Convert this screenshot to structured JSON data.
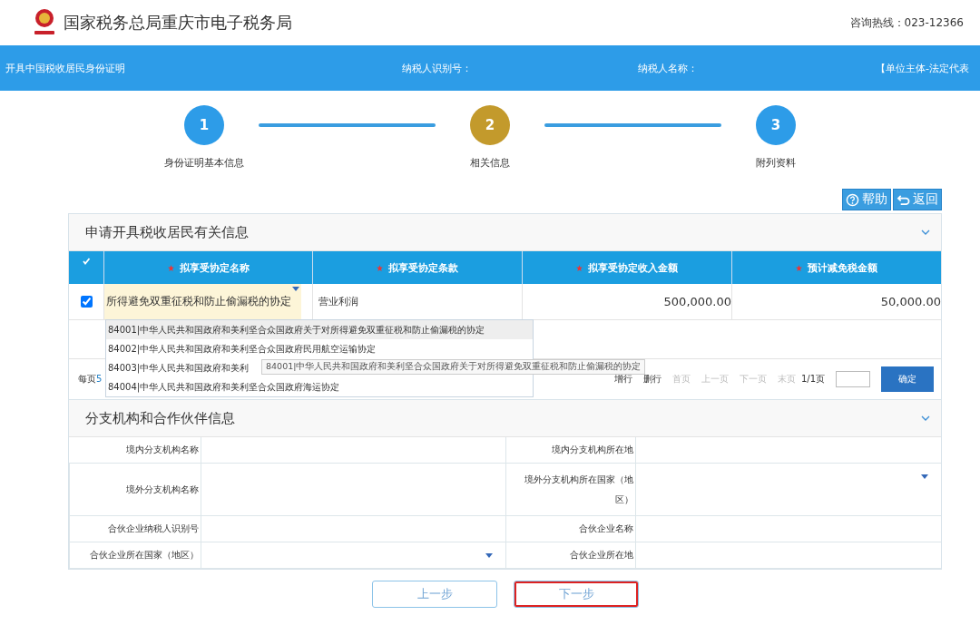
{
  "header": {
    "title": "国家税务总局重庆市电子税务局",
    "hotline": "咨询热线：023-12366"
  },
  "infobar": {
    "items": [
      "开具中国税收居民身份证明",
      "纳税人识别号：",
      "纳税人名称：",
      "【单位主体-法定代表"
    ]
  },
  "steps": [
    {
      "number": "1",
      "label": "身份证明基本信息",
      "current": false
    },
    {
      "number": "2",
      "label": "相关信息",
      "current": true
    },
    {
      "number": "3",
      "label": "附列资料",
      "current": false
    }
  ],
  "tools": [
    "帮助",
    "返回"
  ],
  "treaty_panel": {
    "title": "申请开具税收居民有关信息",
    "expanded": true,
    "header_checked": true,
    "columns": [
      {
        "label": "拟享受协定名称",
        "required": true
      },
      {
        "label": "拟享受协定条款",
        "required": true
      },
      {
        "label": "拟享受协定收入金额",
        "required": true
      },
      {
        "label": "预计减免税金额",
        "required": true
      }
    ],
    "rows": [
      {
        "checked": true,
        "cells": [
          "所得避免双重征税和防止偷漏税的协定",
          "营业利润",
          "500,000.00",
          "50,000.00"
        ]
      }
    ],
    "dropdown": [
      {
        "text": "84001|中华人民共和国政府和美利坚合众国政府关于对所得避免双重征税和防止偷漏税的协定",
        "selected": true
      },
      {
        "text": "84002|中华人民共和国政府和美利坚合众国政府民用航空运输协定",
        "selected": false
      },
      {
        "text": "84003|中华人民共和国政府和美利",
        "selected": false
      },
      {
        "text": "84004|中华人民共和国政府和美利坚合众国政府海运协定",
        "selected": false
      }
    ],
    "tooltip": "84001|中华人民共和国政府和美利坚合众国政府关于对所得避免双重征税和防止偷漏税的协定",
    "pager": {
      "per_page_label": "每页",
      "per_page_value": "5",
      "actions": [
        {
          "label": "增行",
          "disabled": false
        },
        {
          "label": "删行",
          "disabled": false
        },
        {
          "label": "首页",
          "disabled": true
        },
        {
          "label": "上一页",
          "disabled": true
        },
        {
          "label": "下一页",
          "disabled": true
        },
        {
          "label": "末页",
          "disabled": true
        }
      ],
      "page": "1/1页",
      "confirm": "确定"
    }
  },
  "branch_panel": {
    "title": "分支机构和合作伙伴信息",
    "expanded": true,
    "rows": [
      [
        {
          "label": "境内分支机构名称",
          "kind": "text"
        },
        {
          "label": "境内分支机构所在地",
          "kind": "text"
        }
      ],
      [
        {
          "label": "境外分支机构名称",
          "kind": "text"
        },
        {
          "label": "境外分支机构所在国家（地区）",
          "kind": "select"
        }
      ],
      [
        {
          "label": "合伙企业纳税人识别号",
          "kind": "text"
        },
        {
          "label": "合伙企业名称",
          "kind": "text"
        }
      ],
      [
        {
          "label": "合伙企业所在国家（地区）",
          "kind": "select"
        },
        {
          "label": "合伙企业所在地",
          "kind": "text"
        }
      ]
    ]
  },
  "nav": [
    {
      "label": "上一步",
      "highlighted": false
    },
    {
      "label": "下一步",
      "highlighted": true
    }
  ]
}
